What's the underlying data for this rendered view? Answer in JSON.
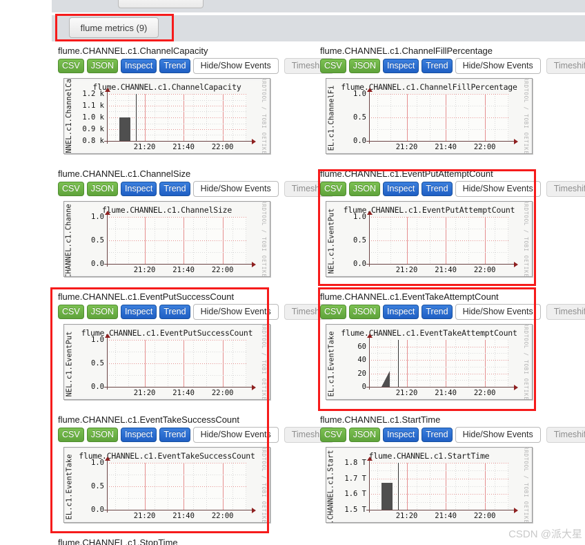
{
  "panel": {
    "tab_label": "flume metrics (9)"
  },
  "buttons": {
    "csv": "CSV",
    "json": "JSON",
    "inspect": "Inspect",
    "trend": "Trend",
    "hide_show": "Hide/Show Events",
    "timeshift": "Timeshift"
  },
  "graph_watermark": "RRDTOOL / TOBI OETIKER",
  "watermark": "CSDN @派大星",
  "bottom_partial_title": "flume.CHANNEL.c1.StopTime",
  "metrics": [
    {
      "title": "flume.CHANNEL.c1.ChannelCapacity",
      "graph_title": "flume.CHANNEL.c1.ChannelCapacity",
      "vertical_label": "ANNEL.c1.ChannelCa",
      "yticks": [
        "1.2 k",
        "1.1 k",
        "1.0 k",
        "0.9 k",
        "0.8 k"
      ],
      "xticks": [
        "21:20",
        "21:40",
        "22:00"
      ]
    },
    {
      "title": "flume.CHANNEL.c1.ChannelFillPercentage",
      "graph_title": "flume.CHANNEL.c1.ChannelFillPercentage",
      "vertical_label": "EL.c1.ChannelFi",
      "yticks": [
        "1.0",
        "0.5",
        "0.0"
      ],
      "xticks": [
        "21:20",
        "21:40",
        "22:00"
      ]
    },
    {
      "title": "flume.CHANNEL.c1.ChannelSize",
      "graph_title": "flume.CHANNEL.c1.ChannelSize",
      "vertical_label": "CHANNEL.c1.Channe",
      "yticks": [
        "1.0",
        "0.5",
        "0.0"
      ],
      "xticks": [
        "21:20",
        "21:40",
        "22:00"
      ]
    },
    {
      "title": "flume.CHANNEL.c1.EventPutAttemptCount",
      "graph_title": "flume.CHANNEL.c1.EventPutAttemptCount",
      "vertical_label": "NEL.c1.EventPut",
      "yticks": [
        "1.0",
        "0.5",
        "0.0"
      ],
      "xticks": [
        "21:20",
        "21:40",
        "22:00"
      ]
    },
    {
      "title": "flume.CHANNEL.c1.EventPutSuccessCount",
      "graph_title": "flume.CHANNEL.c1.EventPutSuccessCount",
      "vertical_label": "NEL.c1.EventPut",
      "yticks": [
        "1.0",
        "0.5",
        "0.0"
      ],
      "xticks": [
        "21:20",
        "21:40",
        "22:00"
      ]
    },
    {
      "title": "flume.CHANNEL.c1.EventTakeAttemptCount",
      "graph_title": "flume.CHANNEL.c1.EventTakeAttemptCount",
      "vertical_label": "EL.c1.EventTake",
      "yticks": [
        "60",
        "40",
        "20",
        "0"
      ],
      "xticks": [
        "21:20",
        "21:40",
        "22:00"
      ]
    },
    {
      "title": "flume.CHANNEL.c1.EventTakeSuccessCount",
      "graph_title": "flume.CHANNEL.c1.EventTakeSuccessCount",
      "vertical_label": "EL.c1.EventTake",
      "yticks": [
        "1.0",
        "0.5",
        "0.0"
      ],
      "xticks": [
        "21:20",
        "21:40",
        "22:00"
      ]
    },
    {
      "title": "flume.CHANNEL.c1.StartTime",
      "graph_title": "flume.CHANNEL.c1.StartTime",
      "vertical_label": ".CHANNEL.c1.Start",
      "yticks": [
        "1.8 T",
        "1.7 T",
        "1.6 T",
        "1.5 T"
      ],
      "xticks": [
        "21:20",
        "21:40",
        "22:00"
      ]
    }
  ],
  "chart_data": [
    {
      "type": "bar",
      "title": "flume.CHANNEL.c1.ChannelCapacity",
      "xlabel": "",
      "ylabel": "ANNEL.c1.ChannelCa",
      "ylim": [
        0.8,
        1.2
      ],
      "ytick_values": [
        1.2,
        1.1,
        1.0,
        0.9,
        0.8
      ],
      "ytick_labels": [
        "1.2 k",
        "1.1 k",
        "1.0 k",
        "0.9 k",
        "0.8 k"
      ],
      "xtick_labels": [
        "21:20",
        "21:40",
        "22:00"
      ],
      "grid": true,
      "series": [
        {
          "name": "ChannelCapacity",
          "x": [
            "21:18"
          ],
          "values": [
            1.0
          ]
        }
      ],
      "annotations": [
        "vertical event marker just after 21:22"
      ]
    },
    {
      "type": "line",
      "title": "flume.CHANNEL.c1.ChannelFillPercentage",
      "xlabel": "",
      "ylabel": "EL.c1.ChannelFi",
      "ylim": [
        0.0,
        1.0
      ],
      "ytick_values": [
        1.0,
        0.5,
        0.0
      ],
      "ytick_labels": [
        "1.0",
        "0.5",
        "0.0"
      ],
      "xtick_labels": [
        "21:20",
        "21:40",
        "22:00"
      ],
      "grid": true,
      "series": [
        {
          "name": "ChannelFillPercentage",
          "x": [],
          "values": []
        }
      ]
    },
    {
      "type": "line",
      "title": "flume.CHANNEL.c1.ChannelSize",
      "xlabel": "",
      "ylabel": "CHANNEL.c1.Channe",
      "ylim": [
        0.0,
        1.0
      ],
      "ytick_values": [
        1.0,
        0.5,
        0.0
      ],
      "ytick_labels": [
        "1.0",
        "0.5",
        "0.0"
      ],
      "xtick_labels": [
        "21:20",
        "21:40",
        "22:00"
      ],
      "grid": true,
      "series": [
        {
          "name": "ChannelSize",
          "x": [],
          "values": []
        }
      ]
    },
    {
      "type": "line",
      "title": "flume.CHANNEL.c1.EventPutAttemptCount",
      "xlabel": "",
      "ylabel": "NEL.c1.EventPut",
      "ylim": [
        0.0,
        1.0
      ],
      "ytick_values": [
        1.0,
        0.5,
        0.0
      ],
      "ytick_labels": [
        "1.0",
        "0.5",
        "0.0"
      ],
      "xtick_labels": [
        "21:20",
        "21:40",
        "22:00"
      ],
      "grid": true,
      "series": [
        {
          "name": "EventPutAttemptCount",
          "x": [],
          "values": []
        }
      ]
    },
    {
      "type": "line",
      "title": "flume.CHANNEL.c1.EventPutSuccessCount",
      "xlabel": "",
      "ylabel": "NEL.c1.EventPut",
      "ylim": [
        0.0,
        1.0
      ],
      "ytick_values": [
        1.0,
        0.5,
        0.0
      ],
      "ytick_labels": [
        "1.0",
        "0.5",
        "0.0"
      ],
      "xtick_labels": [
        "21:20",
        "21:40",
        "22:00"
      ],
      "grid": true,
      "series": [
        {
          "name": "EventPutSuccessCount",
          "x": [],
          "values": []
        }
      ]
    },
    {
      "type": "area",
      "title": "flume.CHANNEL.c1.EventTakeAttemptCount",
      "xlabel": "",
      "ylabel": "EL.c1.EventTake",
      "ylim": [
        0,
        70
      ],
      "ytick_values": [
        60,
        40,
        20,
        0
      ],
      "ytick_labels": [
        "60",
        "40",
        "20",
        "0"
      ],
      "xtick_labels": [
        "21:20",
        "21:40",
        "22:00"
      ],
      "grid": true,
      "series": [
        {
          "name": "EventTakeAttemptCount",
          "x": [
            "21:17",
            "21:19",
            "21:21"
          ],
          "values": [
            0,
            12,
            24
          ]
        }
      ],
      "annotations": [
        "ramp rises from 0 to about 24 then drops; vertical event marker just after 21:22"
      ]
    },
    {
      "type": "line",
      "title": "flume.CHANNEL.c1.EventTakeSuccessCount",
      "xlabel": "",
      "ylabel": "EL.c1.EventTake",
      "ylim": [
        0.0,
        1.0
      ],
      "ytick_values": [
        1.0,
        0.5,
        0.0
      ],
      "ytick_labels": [
        "1.0",
        "0.5",
        "0.0"
      ],
      "xtick_labels": [
        "21:20",
        "21:40",
        "22:00"
      ],
      "grid": true,
      "series": [
        {
          "name": "EventTakeSuccessCount",
          "x": [],
          "values": []
        }
      ]
    },
    {
      "type": "bar",
      "title": "flume.CHANNEL.c1.StartTime",
      "xlabel": "",
      "ylabel": ".CHANNEL.c1.Start",
      "ylim": [
        1.5,
        1.8
      ],
      "ytick_values": [
        1.8,
        1.7,
        1.6,
        1.5
      ],
      "ytick_labels": [
        "1.8 T",
        "1.7 T",
        "1.6 T",
        "1.5 T"
      ],
      "xtick_labels": [
        "21:20",
        "21:40",
        "22:00"
      ],
      "grid": true,
      "series": [
        {
          "name": "StartTime",
          "x": [
            "21:18"
          ],
          "values": [
            1.67
          ]
        }
      ],
      "annotations": [
        "vertical event marker just after 21:22"
      ]
    }
  ]
}
